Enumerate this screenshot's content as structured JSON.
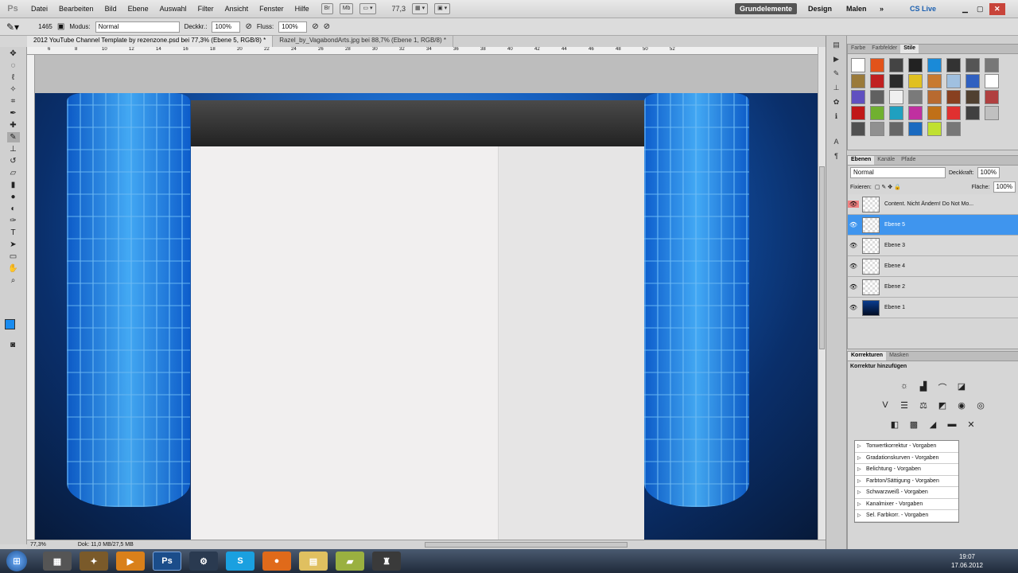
{
  "menubar": {
    "logo": "Ps",
    "items": [
      "Datei",
      "Bearbeiten",
      "Bild",
      "Ebene",
      "Auswahl",
      "Filter",
      "Ansicht",
      "Fenster",
      "Hilfe"
    ],
    "mini": [
      "Br",
      "Mb"
    ],
    "zoom": "77,3",
    "workspaces": [
      "Grundelemente",
      "Design",
      "Malen"
    ],
    "cslive": "CS Live"
  },
  "options": {
    "brush_size": "1465",
    "mode_label": "Modus:",
    "mode_value": "Normal",
    "opacity_label": "Deckkr.:",
    "opacity_value": "100%",
    "flow_label": "Fluss:",
    "flow_value": "100%"
  },
  "tabs": [
    "2012 YouTube Channel Template by rezenzone.psd bei 77,3% (Ebene 5, RGB/8) *",
    "Razel_by_VagabondArts.jpg bei 88,7% (Ebene 1, RGB/8) *"
  ],
  "ruler_top": [
    "6",
    "8",
    "10",
    "12",
    "14",
    "16",
    "18",
    "20",
    "22",
    "24",
    "26",
    "28",
    "30",
    "32",
    "34",
    "36",
    "38",
    "40",
    "42",
    "44",
    "46",
    "48",
    "50",
    "52"
  ],
  "status": {
    "zoom": "77,3%",
    "doc": "Dok: 11,0 MB/27,5 MB"
  },
  "styles_panel": {
    "tabs": [
      "Farbe",
      "Farbfelder",
      "Stile"
    ],
    "active": "Stile"
  },
  "layers_panel": {
    "tabs": [
      "Ebenen",
      "Kanäle",
      "Pfade"
    ],
    "blend": "Normal",
    "opacity_label": "Deckkraft:",
    "opacity": "100%",
    "lock_label": "Fixieren:",
    "fill_label": "Fläche:",
    "fill": "100%",
    "layers": [
      {
        "name": "Content. Nicht Ändern! Do Not Mo...",
        "selected": false
      },
      {
        "name": "Ebene 5",
        "selected": true
      },
      {
        "name": "Ebene 3",
        "selected": false
      },
      {
        "name": "Ebene 4",
        "selected": false
      },
      {
        "name": "Ebene 2",
        "selected": false
      },
      {
        "name": "Ebene 1",
        "selected": false
      }
    ]
  },
  "adjust_panel": {
    "tabs": [
      "Korrekturen",
      "Masken"
    ],
    "title": "Korrektur hinzufügen",
    "presets": [
      "Tonwertkorrektur - Vorgaben",
      "Gradationskurven - Vorgaben",
      "Belichtung - Vorgaben",
      "Farbton/Sättigung - Vorgaben",
      "Schwarzweiß - Vorgaben",
      "Kanalmixer - Vorgaben",
      "Sel. Farbkorr. - Vorgaben"
    ]
  },
  "taskbar": {
    "ps_label": "Ps",
    "time": "19:07",
    "date": "17.06.2012"
  }
}
